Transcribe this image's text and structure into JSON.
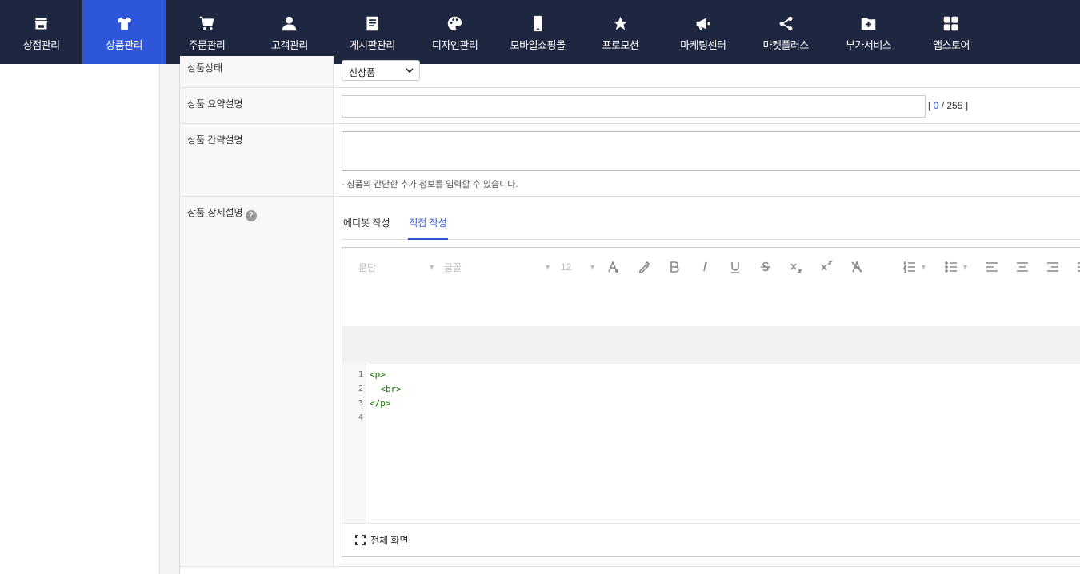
{
  "nav": {
    "items": [
      {
        "label": "상점관리",
        "icon": "store-icon"
      },
      {
        "label": "상품관리",
        "icon": "tshirt-icon"
      },
      {
        "label": "주문관리",
        "icon": "cart-icon"
      },
      {
        "label": "고객관리",
        "icon": "person-icon"
      },
      {
        "label": "게시판관리",
        "icon": "board-icon"
      },
      {
        "label": "디자인관리",
        "icon": "palette-icon"
      },
      {
        "label": "모바일쇼핑몰",
        "icon": "mobile-icon"
      },
      {
        "label": "프로모션",
        "icon": "star-icon"
      },
      {
        "label": "마케팅센터",
        "icon": "megaphone-icon"
      },
      {
        "label": "마켓플러스",
        "icon": "share-icon"
      },
      {
        "label": "부가서비스",
        "icon": "folder-plus-icon"
      },
      {
        "label": "앱스토어",
        "icon": "apps-grid-icon"
      }
    ],
    "active_index": 1,
    "active_color": "#2e56d8",
    "background": "#1f2640"
  },
  "form": {
    "status": {
      "label": "상품상태",
      "value": "신상품"
    },
    "summary": {
      "label": "상품 요약설명",
      "value": "",
      "count_open": "[ ",
      "count_current": "0",
      "count_sep": " / ",
      "count_max": "255",
      "count_close": " ]"
    },
    "brief": {
      "label": "상품 간략설명",
      "value": "",
      "hint": "- 상품의 간단한 추가 정보를 입력할 수 있습니다."
    },
    "detail": {
      "label": "상품 상세설명",
      "help": "?",
      "tabs": [
        {
          "label": "에디봇 작성",
          "active": false
        },
        {
          "label": "직접 작성",
          "active": true
        }
      ],
      "toolbar": {
        "paragraph": "문단",
        "font": "글꼴",
        "size": "12"
      },
      "code_lines": [
        {
          "num": "1",
          "text": "<p>"
        },
        {
          "num": "2",
          "text": "  <br>"
        },
        {
          "num": "3",
          "text": "</p>"
        },
        {
          "num": "4",
          "text": ""
        }
      ],
      "fullscreen_label": "전체 화면"
    }
  }
}
